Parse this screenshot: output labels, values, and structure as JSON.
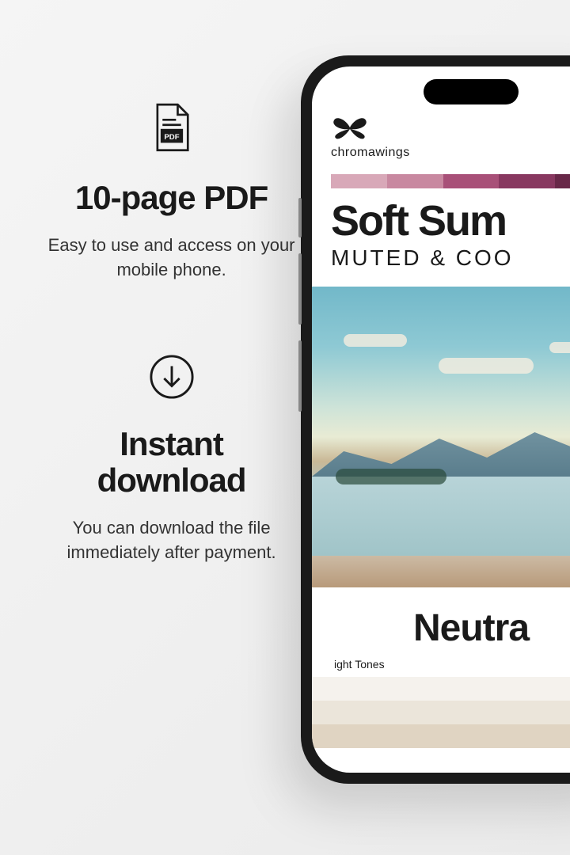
{
  "features": {
    "pdf": {
      "title": "10-page PDF",
      "subtitle": "Easy to use and access on your mobile phone."
    },
    "download": {
      "title": "Instant download",
      "subtitle": "You can download the file immediately after payment."
    }
  },
  "phone": {
    "brand": "chromawings",
    "productTitle": "Soft Sum",
    "productSubtitle": "MUTED & COO",
    "sectionTitle": "Neutra",
    "toneLabel": "ight Tones",
    "colorStrip": [
      "#d8a8b8",
      "#c888a0",
      "#a85078",
      "#883860",
      "#682848"
    ],
    "toneSwatches": [
      "#f5f2ed",
      "#ebe5da",
      "#e0d4c2"
    ]
  }
}
